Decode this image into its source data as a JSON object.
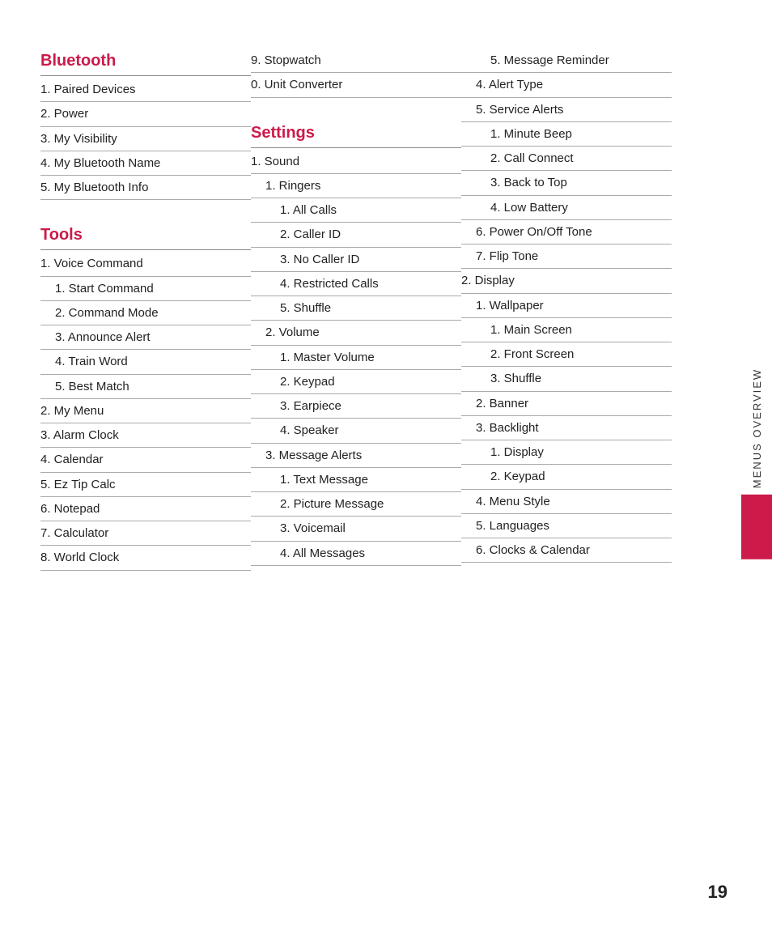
{
  "columns": {
    "col1": {
      "sections": [
        {
          "header": "Bluetooth",
          "items": [
            {
              "level": 0,
              "text": "1.  Paired Devices"
            },
            {
              "level": 0,
              "text": "2.  Power"
            },
            {
              "level": 0,
              "text": "3.  My Visibility"
            },
            {
              "level": 0,
              "text": "4.  My Bluetooth Name"
            },
            {
              "level": 0,
              "text": "5.  My Bluetooth Info"
            }
          ]
        },
        {
          "header": "Tools",
          "items": [
            {
              "level": 0,
              "text": "1.  Voice Command"
            },
            {
              "level": 1,
              "text": "1.  Start Command"
            },
            {
              "level": 1,
              "text": "2.  Command Mode"
            },
            {
              "level": 1,
              "text": "3.  Announce Alert"
            },
            {
              "level": 1,
              "text": "4.  Train Word"
            },
            {
              "level": 1,
              "text": "5.  Best Match"
            },
            {
              "level": 0,
              "text": "2.  My Menu"
            },
            {
              "level": 0,
              "text": "3.  Alarm Clock"
            },
            {
              "level": 0,
              "text": "4.  Calendar"
            },
            {
              "level": 0,
              "text": "5.  Ez Tip Calc"
            },
            {
              "level": 0,
              "text": "6.  Notepad"
            },
            {
              "level": 0,
              "text": "7.  Calculator"
            },
            {
              "level": 0,
              "text": "8.  World Clock"
            }
          ]
        }
      ]
    },
    "col2": {
      "items": [
        {
          "level": 0,
          "text": "9.  Stopwatch"
        },
        {
          "level": 0,
          "text": "0.  Unit Converter"
        },
        {
          "separator": true
        },
        {
          "header": "Settings"
        },
        {
          "level": 0,
          "text": "1.  Sound"
        },
        {
          "level": 1,
          "text": "1.  Ringers"
        },
        {
          "level": 2,
          "text": "1.  All Calls"
        },
        {
          "level": 2,
          "text": "2.  Caller ID"
        },
        {
          "level": 2,
          "text": "3.  No Caller ID"
        },
        {
          "level": 2,
          "text": "4.  Restricted Calls"
        },
        {
          "level": 2,
          "text": "5.  Shuffle"
        },
        {
          "level": 1,
          "text": "2.  Volume"
        },
        {
          "level": 2,
          "text": "1.  Master Volume"
        },
        {
          "level": 2,
          "text": "2.  Keypad"
        },
        {
          "level": 2,
          "text": "3.  Earpiece"
        },
        {
          "level": 2,
          "text": "4.  Speaker"
        },
        {
          "level": 1,
          "text": "3.  Message Alerts"
        },
        {
          "level": 2,
          "text": "1.  Text Message"
        },
        {
          "level": 2,
          "text": "2.  Picture Message"
        },
        {
          "level": 2,
          "text": "3.  Voicemail"
        },
        {
          "level": 2,
          "text": "4.  All Messages"
        }
      ]
    },
    "col3": {
      "items": [
        {
          "level": 2,
          "text": "5.  Message Reminder"
        },
        {
          "level": 1,
          "text": "4.  Alert Type"
        },
        {
          "level": 1,
          "text": "5.  Service Alerts"
        },
        {
          "level": 2,
          "text": "1.  Minute Beep"
        },
        {
          "level": 2,
          "text": "2.  Call Connect"
        },
        {
          "level": 2,
          "text": "3.  Back to Top"
        },
        {
          "level": 2,
          "text": "4.  Low Battery"
        },
        {
          "level": 1,
          "text": "6.  Power On/Off Tone"
        },
        {
          "level": 1,
          "text": "7.  Flip Tone"
        },
        {
          "level": 0,
          "text": "2.  Display"
        },
        {
          "level": 1,
          "text": "1.  Wallpaper"
        },
        {
          "level": 2,
          "text": "1.  Main Screen"
        },
        {
          "level": 2,
          "text": "2.  Front Screen"
        },
        {
          "level": 2,
          "text": "3.  Shuffle"
        },
        {
          "level": 1,
          "text": "2.  Banner"
        },
        {
          "level": 1,
          "text": "3.  Backlight"
        },
        {
          "level": 2,
          "text": "1.  Display"
        },
        {
          "level": 2,
          "text": "2.  Keypad"
        },
        {
          "level": 1,
          "text": "4.  Menu Style"
        },
        {
          "level": 1,
          "text": "5.  Languages"
        },
        {
          "level": 1,
          "text": "6.  Clocks & Calendar"
        }
      ]
    }
  },
  "side_tab": {
    "text": "Menus Overview"
  },
  "page_number": "19"
}
